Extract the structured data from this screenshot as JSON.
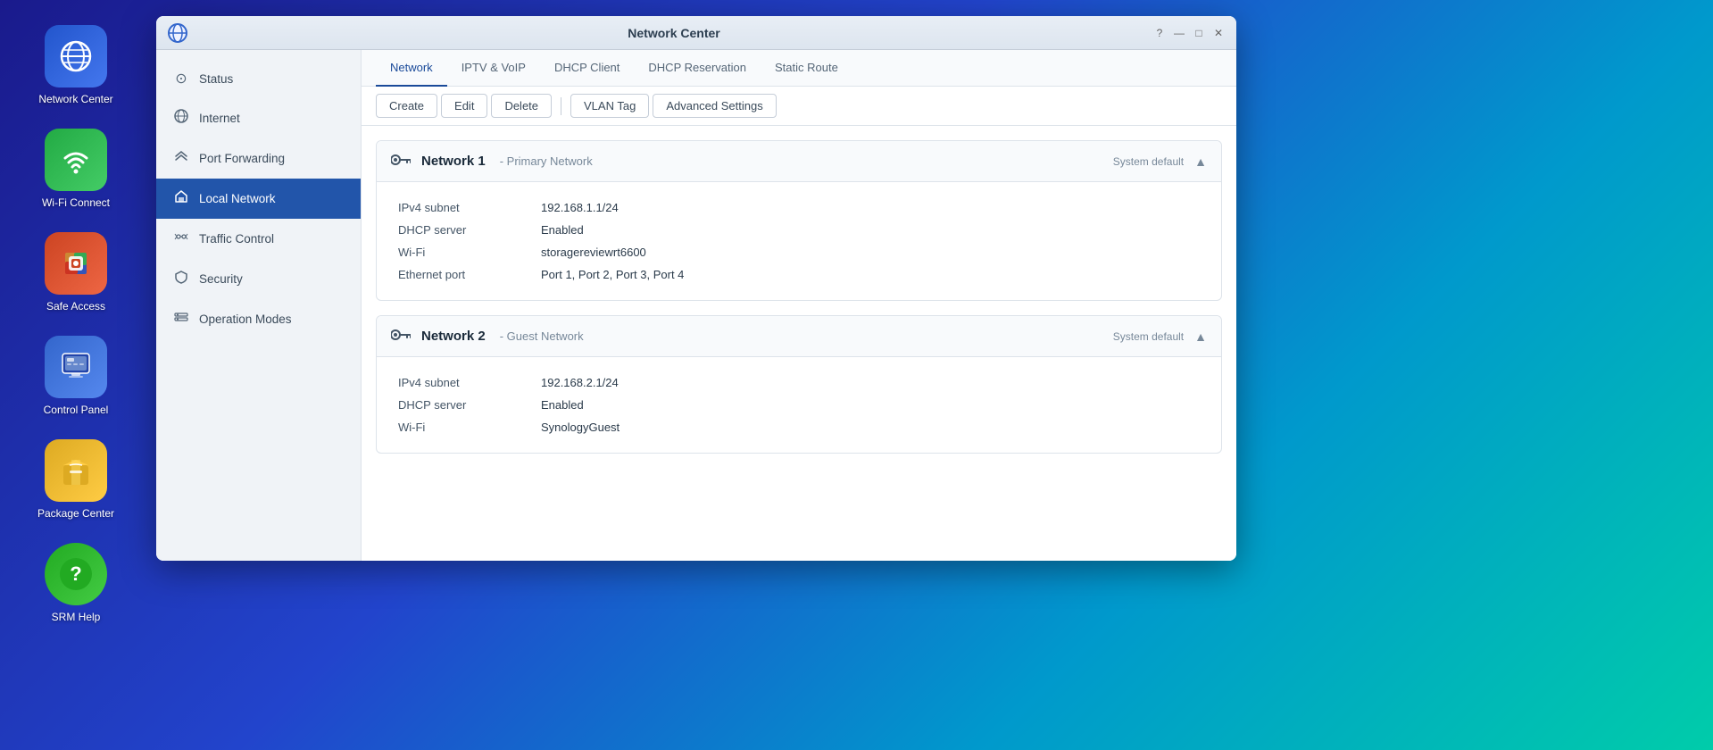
{
  "window": {
    "title": "Network Center",
    "logo_char": "🌐"
  },
  "sidebar": {
    "items": [
      {
        "id": "network-center",
        "label": "Network Center",
        "icon": "🌐",
        "bg_class": "icon-network"
      },
      {
        "id": "wifi-connect",
        "label": "Wi-Fi Connect",
        "icon": "📶",
        "bg_class": "icon-wifi"
      },
      {
        "id": "safe-access",
        "label": "Safe Access",
        "icon": "🔒",
        "bg_class": "icon-safe"
      },
      {
        "id": "control-panel",
        "label": "Control Panel",
        "icon": "🖥",
        "bg_class": "icon-control"
      },
      {
        "id": "package-center",
        "label": "Package Center",
        "icon": "🎁",
        "bg_class": "icon-package"
      },
      {
        "id": "srm-help",
        "label": "SRM Help",
        "icon": "❓",
        "bg_class": "icon-help"
      }
    ]
  },
  "nav": {
    "items": [
      {
        "id": "status",
        "label": "Status",
        "icon": "⊙"
      },
      {
        "id": "internet",
        "label": "Internet",
        "icon": "🌍"
      },
      {
        "id": "port-forwarding",
        "label": "Port Forwarding",
        "icon": "↗"
      },
      {
        "id": "local-network",
        "label": "Local Network",
        "icon": "🏠",
        "active": true
      },
      {
        "id": "traffic-control",
        "label": "Traffic Control",
        "icon": "⚖"
      },
      {
        "id": "security",
        "label": "Security",
        "icon": "🛡"
      },
      {
        "id": "operation-modes",
        "label": "Operation Modes",
        "icon": "⚙"
      }
    ]
  },
  "tabs": [
    {
      "id": "network",
      "label": "Network",
      "active": true
    },
    {
      "id": "iptv-voip",
      "label": "IPTV & VoIP",
      "active": false
    },
    {
      "id": "dhcp-client",
      "label": "DHCP Client",
      "active": false
    },
    {
      "id": "dhcp-reservation",
      "label": "DHCP Reservation",
      "active": false
    },
    {
      "id": "static-route",
      "label": "Static Route",
      "active": false
    }
  ],
  "toolbar": {
    "create_label": "Create",
    "edit_label": "Edit",
    "delete_label": "Delete",
    "vlan_tag_label": "VLAN Tag",
    "advanced_settings_label": "Advanced Settings"
  },
  "networks": [
    {
      "id": "network1",
      "name": "Network 1",
      "type": "Primary Network",
      "badge": "System default",
      "fields": [
        {
          "label": "IPv4 subnet",
          "value": "192.168.1.1/24"
        },
        {
          "label": "DHCP server",
          "value": "Enabled"
        },
        {
          "label": "Wi-Fi",
          "value": "storagereviewrt6600"
        },
        {
          "label": "Ethernet port",
          "value": "Port 1, Port 2, Port 3, Port 4"
        }
      ]
    },
    {
      "id": "network2",
      "name": "Network 2",
      "type": "Guest Network",
      "badge": "System default",
      "fields": [
        {
          "label": "IPv4 subnet",
          "value": "192.168.2.1/24"
        },
        {
          "label": "DHCP server",
          "value": "Enabled"
        },
        {
          "label": "Wi-Fi",
          "value": "SynologyGuest"
        }
      ]
    }
  ]
}
